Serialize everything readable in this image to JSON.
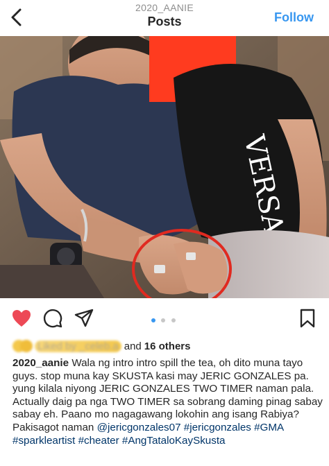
{
  "header": {
    "username": "2020_AANIE",
    "title": "Posts",
    "follow_label": "Follow"
  },
  "post": {
    "carousel": {
      "count": 3,
      "active_index": 0
    },
    "likes": {
      "liked_by_text": "Liked by _celeb.a",
      "and_text": "and",
      "others_text": "16 others"
    },
    "caption": {
      "username": "2020_aanie",
      "text": "Wala ng intro intro spill the tea, oh dito muna tayo guys. stop muna kay SKUSTA kasi may JERIC GONZALES pa. yung kilala niyong JERIC GONZALES TWO TIMER naman pala. Actually daig pa nga TWO TIMER sa sobrang daming pinag sabay sabay eh. Paano mo nagagawang lokohin ang isang Rabiya? Pakisagot naman",
      "hashtags": [
        "@jericgonzales07",
        "#jericgonzales",
        "#GMA",
        "#sparkleartist",
        "#cheater",
        "#AngTataloKaySkusta"
      ]
    },
    "photo": {
      "shirt_text": "VERSACE"
    }
  },
  "colors": {
    "like_red": "#ed4956",
    "link_blue": "#3897f0",
    "tag_blue": "#003569",
    "redaction": "#ff3b1f",
    "circle_red": "#e02a20"
  },
  "icons": [
    "back-chevron-icon",
    "heart-icon",
    "comment-icon",
    "share-icon",
    "bookmark-icon"
  ]
}
